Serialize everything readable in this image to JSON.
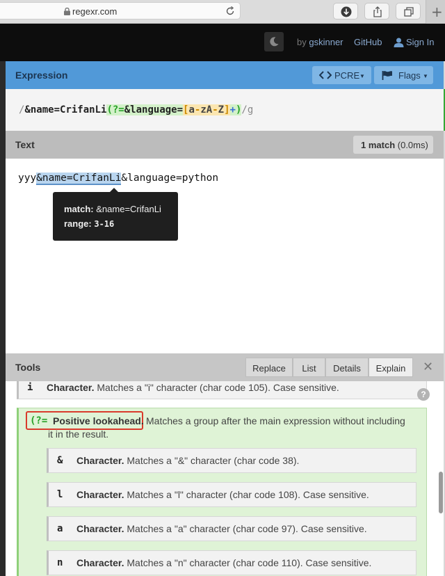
{
  "browser": {
    "url": "regexr.com",
    "icons": [
      "lock-icon",
      "reload-icon",
      "download-icon",
      "share-icon",
      "tabs-icon",
      "new-tab-icon"
    ]
  },
  "header": {
    "by_prefix": "by",
    "author": "gskinner",
    "github": "GitHub",
    "signin": "Sign In"
  },
  "expression": {
    "title": "Expression",
    "engine": "PCRE",
    "flags_label": "Flags",
    "open_slash": "/",
    "literal": "&name=CrifanLi",
    "lookahead_open": "(?=",
    "lookahead_text": "&language=",
    "set_open": "[",
    "set_a": "a",
    "set_dash1": "-",
    "set_zA": "zA",
    "set_dash2": "-",
    "set_Z": "Z",
    "set_close": "]",
    "quantifier": "+",
    "lookahead_close": ")",
    "close_flags": "/g"
  },
  "text": {
    "title": "Text",
    "match_count": "1 match",
    "match_time": "(0.0ms)",
    "before": "yyy",
    "match": "&name=CrifanLi",
    "after": "&language=python",
    "tooltip": {
      "match_label": "match:",
      "match_value": "&name=CrifanLi",
      "range_label": "range:",
      "range_value": "3-16"
    }
  },
  "tools": {
    "title": "Tools",
    "tabs": [
      "Replace",
      "List",
      "Details",
      "Explain"
    ],
    "active_tab": "Explain",
    "close": "✕",
    "explain": {
      "top_row": {
        "token": "i",
        "name": "Character.",
        "desc": "Matches a \"i\" character (char code 105). Case sensitive."
      },
      "group": {
        "token": "(?=",
        "name": "Positive lookahead.",
        "desc_line1": "Matches a group after the main expression without including",
        "desc_line2": "it in the result."
      },
      "children": [
        {
          "token": "&",
          "name": "Character.",
          "desc": "Matches a \"&\" character (char code 38)."
        },
        {
          "token": "l",
          "name": "Character.",
          "desc": "Matches a \"l\" character (char code 108). Case sensitive."
        },
        {
          "token": "a",
          "name": "Character.",
          "desc": "Matches a \"a\" character (char code 97). Case sensitive."
        },
        {
          "token": "n",
          "name": "Character.",
          "desc": "Matches a \"n\" character (char code 110). Case sensitive."
        }
      ],
      "help": "?"
    }
  },
  "colors": {
    "header_blue": "#5199d8",
    "lookahead_green": "#28a228",
    "match_highlight": "#b9d5ef",
    "annotation_red": "#d93a2b"
  }
}
